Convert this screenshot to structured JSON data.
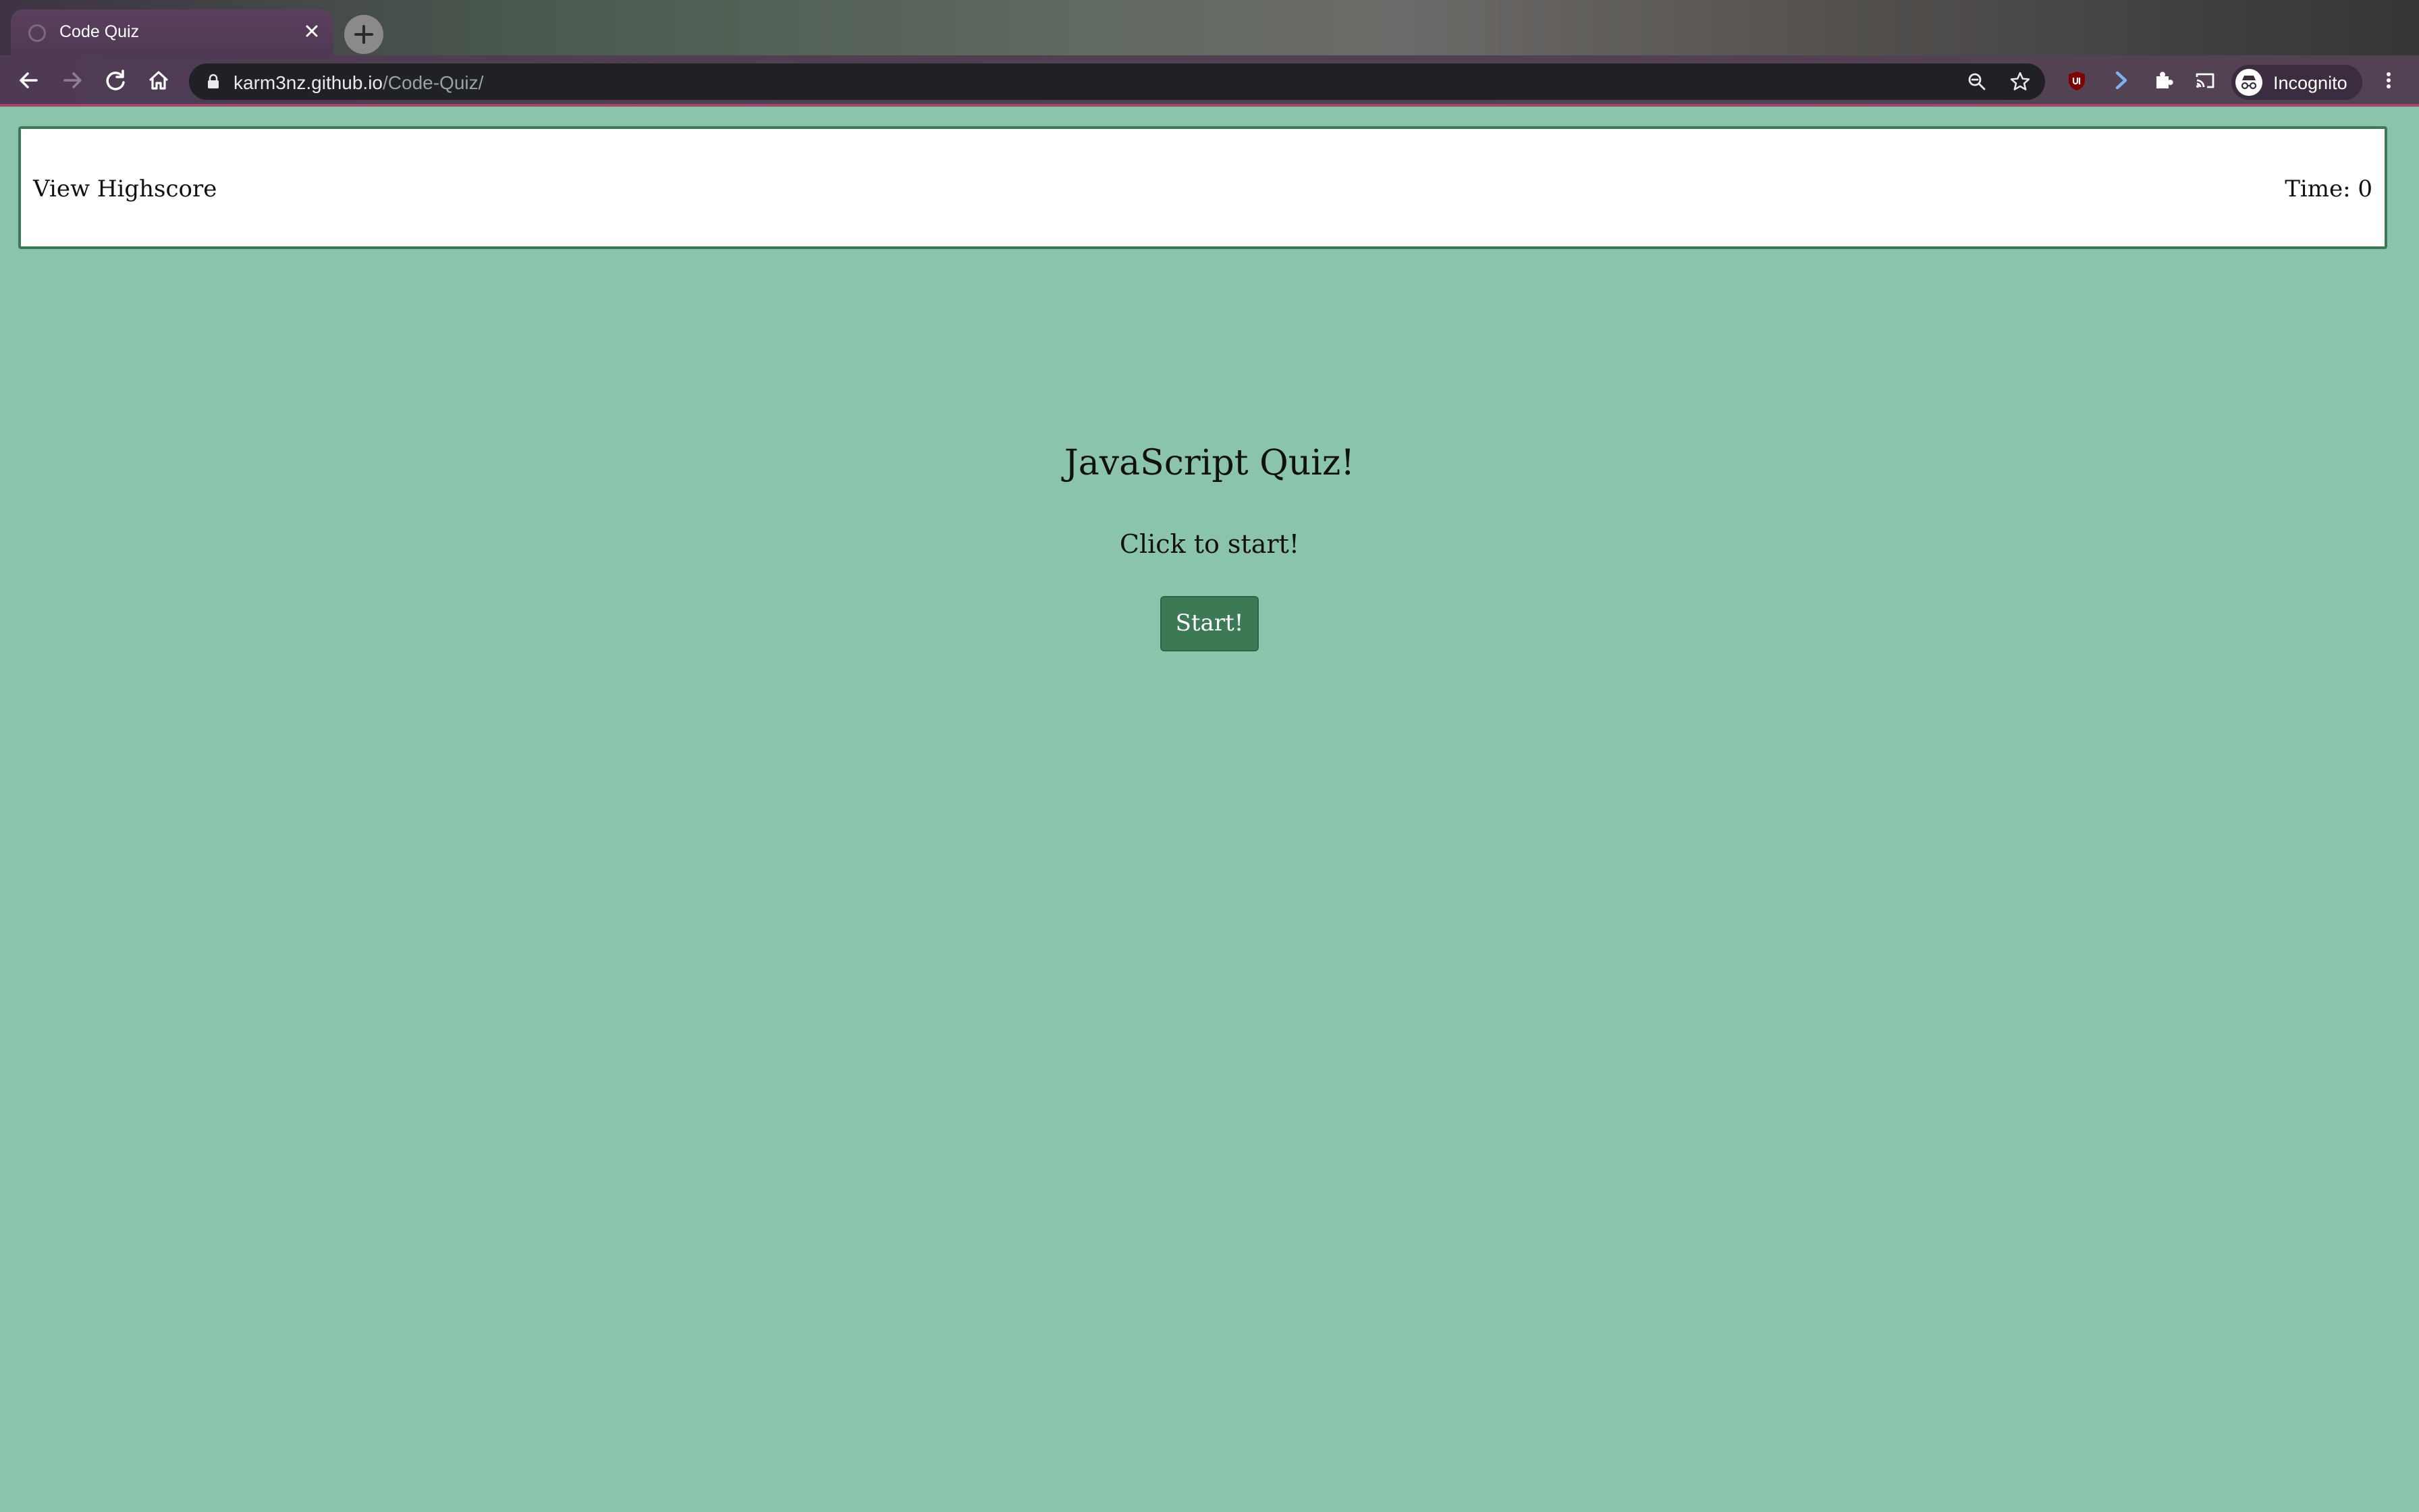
{
  "browser": {
    "tab_title": "Code Quiz",
    "url_host": "karm3nz.github.io",
    "url_path": "/Code-Quiz/",
    "profile_label": "Incognito",
    "icons": {
      "back": "arrow-left-icon",
      "forward": "arrow-right-icon",
      "reload": "reload-icon",
      "home": "home-icon",
      "lock": "lock-icon",
      "zoom": "zoom-icon",
      "bookmark": "star-icon",
      "ublock": "ublock-icon",
      "extension_arrow": "extension-arrow-icon",
      "extensions": "puzzle-icon",
      "cast": "cast-icon",
      "incognito": "incognito-icon",
      "menu": "kebab-menu-icon"
    }
  },
  "page": {
    "header": {
      "highscore_link": "View Highscore",
      "timer_text": "Time: 0"
    },
    "title": "JavaScript Quiz!",
    "subtitle": "Click to start!",
    "start_button": "Start!"
  },
  "colors": {
    "page_background": "#8ac4aa",
    "accent_green": "#3c7a56",
    "header_background": "#ffffff"
  }
}
